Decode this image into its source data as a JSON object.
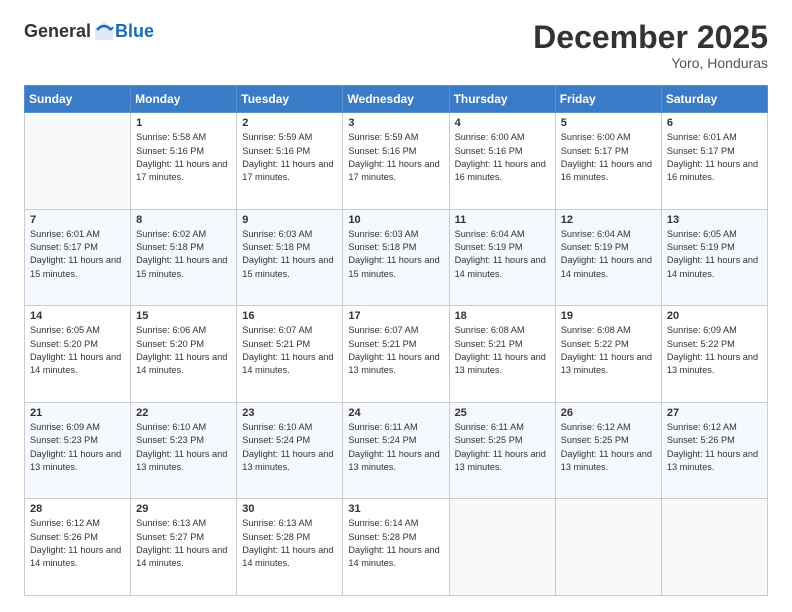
{
  "header": {
    "logo_general": "General",
    "logo_blue": "Blue",
    "month_title": "December 2025",
    "location": "Yoro, Honduras"
  },
  "days_of_week": [
    "Sunday",
    "Monday",
    "Tuesday",
    "Wednesday",
    "Thursday",
    "Friday",
    "Saturday"
  ],
  "weeks": [
    [
      {
        "day": "",
        "sunrise": "",
        "sunset": "",
        "daylight": ""
      },
      {
        "day": "1",
        "sunrise": "Sunrise: 5:58 AM",
        "sunset": "Sunset: 5:16 PM",
        "daylight": "Daylight: 11 hours and 17 minutes."
      },
      {
        "day": "2",
        "sunrise": "Sunrise: 5:59 AM",
        "sunset": "Sunset: 5:16 PM",
        "daylight": "Daylight: 11 hours and 17 minutes."
      },
      {
        "day": "3",
        "sunrise": "Sunrise: 5:59 AM",
        "sunset": "Sunset: 5:16 PM",
        "daylight": "Daylight: 11 hours and 17 minutes."
      },
      {
        "day": "4",
        "sunrise": "Sunrise: 6:00 AM",
        "sunset": "Sunset: 5:16 PM",
        "daylight": "Daylight: 11 hours and 16 minutes."
      },
      {
        "day": "5",
        "sunrise": "Sunrise: 6:00 AM",
        "sunset": "Sunset: 5:17 PM",
        "daylight": "Daylight: 11 hours and 16 minutes."
      },
      {
        "day": "6",
        "sunrise": "Sunrise: 6:01 AM",
        "sunset": "Sunset: 5:17 PM",
        "daylight": "Daylight: 11 hours and 16 minutes."
      }
    ],
    [
      {
        "day": "7",
        "sunrise": "Sunrise: 6:01 AM",
        "sunset": "Sunset: 5:17 PM",
        "daylight": "Daylight: 11 hours and 15 minutes."
      },
      {
        "day": "8",
        "sunrise": "Sunrise: 6:02 AM",
        "sunset": "Sunset: 5:18 PM",
        "daylight": "Daylight: 11 hours and 15 minutes."
      },
      {
        "day": "9",
        "sunrise": "Sunrise: 6:03 AM",
        "sunset": "Sunset: 5:18 PM",
        "daylight": "Daylight: 11 hours and 15 minutes."
      },
      {
        "day": "10",
        "sunrise": "Sunrise: 6:03 AM",
        "sunset": "Sunset: 5:18 PM",
        "daylight": "Daylight: 11 hours and 15 minutes."
      },
      {
        "day": "11",
        "sunrise": "Sunrise: 6:04 AM",
        "sunset": "Sunset: 5:19 PM",
        "daylight": "Daylight: 11 hours and 14 minutes."
      },
      {
        "day": "12",
        "sunrise": "Sunrise: 6:04 AM",
        "sunset": "Sunset: 5:19 PM",
        "daylight": "Daylight: 11 hours and 14 minutes."
      },
      {
        "day": "13",
        "sunrise": "Sunrise: 6:05 AM",
        "sunset": "Sunset: 5:19 PM",
        "daylight": "Daylight: 11 hours and 14 minutes."
      }
    ],
    [
      {
        "day": "14",
        "sunrise": "Sunrise: 6:05 AM",
        "sunset": "Sunset: 5:20 PM",
        "daylight": "Daylight: 11 hours and 14 minutes."
      },
      {
        "day": "15",
        "sunrise": "Sunrise: 6:06 AM",
        "sunset": "Sunset: 5:20 PM",
        "daylight": "Daylight: 11 hours and 14 minutes."
      },
      {
        "day": "16",
        "sunrise": "Sunrise: 6:07 AM",
        "sunset": "Sunset: 5:21 PM",
        "daylight": "Daylight: 11 hours and 14 minutes."
      },
      {
        "day": "17",
        "sunrise": "Sunrise: 6:07 AM",
        "sunset": "Sunset: 5:21 PM",
        "daylight": "Daylight: 11 hours and 13 minutes."
      },
      {
        "day": "18",
        "sunrise": "Sunrise: 6:08 AM",
        "sunset": "Sunset: 5:21 PM",
        "daylight": "Daylight: 11 hours and 13 minutes."
      },
      {
        "day": "19",
        "sunrise": "Sunrise: 6:08 AM",
        "sunset": "Sunset: 5:22 PM",
        "daylight": "Daylight: 11 hours and 13 minutes."
      },
      {
        "day": "20",
        "sunrise": "Sunrise: 6:09 AM",
        "sunset": "Sunset: 5:22 PM",
        "daylight": "Daylight: 11 hours and 13 minutes."
      }
    ],
    [
      {
        "day": "21",
        "sunrise": "Sunrise: 6:09 AM",
        "sunset": "Sunset: 5:23 PM",
        "daylight": "Daylight: 11 hours and 13 minutes."
      },
      {
        "day": "22",
        "sunrise": "Sunrise: 6:10 AM",
        "sunset": "Sunset: 5:23 PM",
        "daylight": "Daylight: 11 hours and 13 minutes."
      },
      {
        "day": "23",
        "sunrise": "Sunrise: 6:10 AM",
        "sunset": "Sunset: 5:24 PM",
        "daylight": "Daylight: 11 hours and 13 minutes."
      },
      {
        "day": "24",
        "sunrise": "Sunrise: 6:11 AM",
        "sunset": "Sunset: 5:24 PM",
        "daylight": "Daylight: 11 hours and 13 minutes."
      },
      {
        "day": "25",
        "sunrise": "Sunrise: 6:11 AM",
        "sunset": "Sunset: 5:25 PM",
        "daylight": "Daylight: 11 hours and 13 minutes."
      },
      {
        "day": "26",
        "sunrise": "Sunrise: 6:12 AM",
        "sunset": "Sunset: 5:25 PM",
        "daylight": "Daylight: 11 hours and 13 minutes."
      },
      {
        "day": "27",
        "sunrise": "Sunrise: 6:12 AM",
        "sunset": "Sunset: 5:26 PM",
        "daylight": "Daylight: 11 hours and 13 minutes."
      }
    ],
    [
      {
        "day": "28",
        "sunrise": "Sunrise: 6:12 AM",
        "sunset": "Sunset: 5:26 PM",
        "daylight": "Daylight: 11 hours and 14 minutes."
      },
      {
        "day": "29",
        "sunrise": "Sunrise: 6:13 AM",
        "sunset": "Sunset: 5:27 PM",
        "daylight": "Daylight: 11 hours and 14 minutes."
      },
      {
        "day": "30",
        "sunrise": "Sunrise: 6:13 AM",
        "sunset": "Sunset: 5:28 PM",
        "daylight": "Daylight: 11 hours and 14 minutes."
      },
      {
        "day": "31",
        "sunrise": "Sunrise: 6:14 AM",
        "sunset": "Sunset: 5:28 PM",
        "daylight": "Daylight: 11 hours and 14 minutes."
      },
      {
        "day": "",
        "sunrise": "",
        "sunset": "",
        "daylight": ""
      },
      {
        "day": "",
        "sunrise": "",
        "sunset": "",
        "daylight": ""
      },
      {
        "day": "",
        "sunrise": "",
        "sunset": "",
        "daylight": ""
      }
    ]
  ]
}
